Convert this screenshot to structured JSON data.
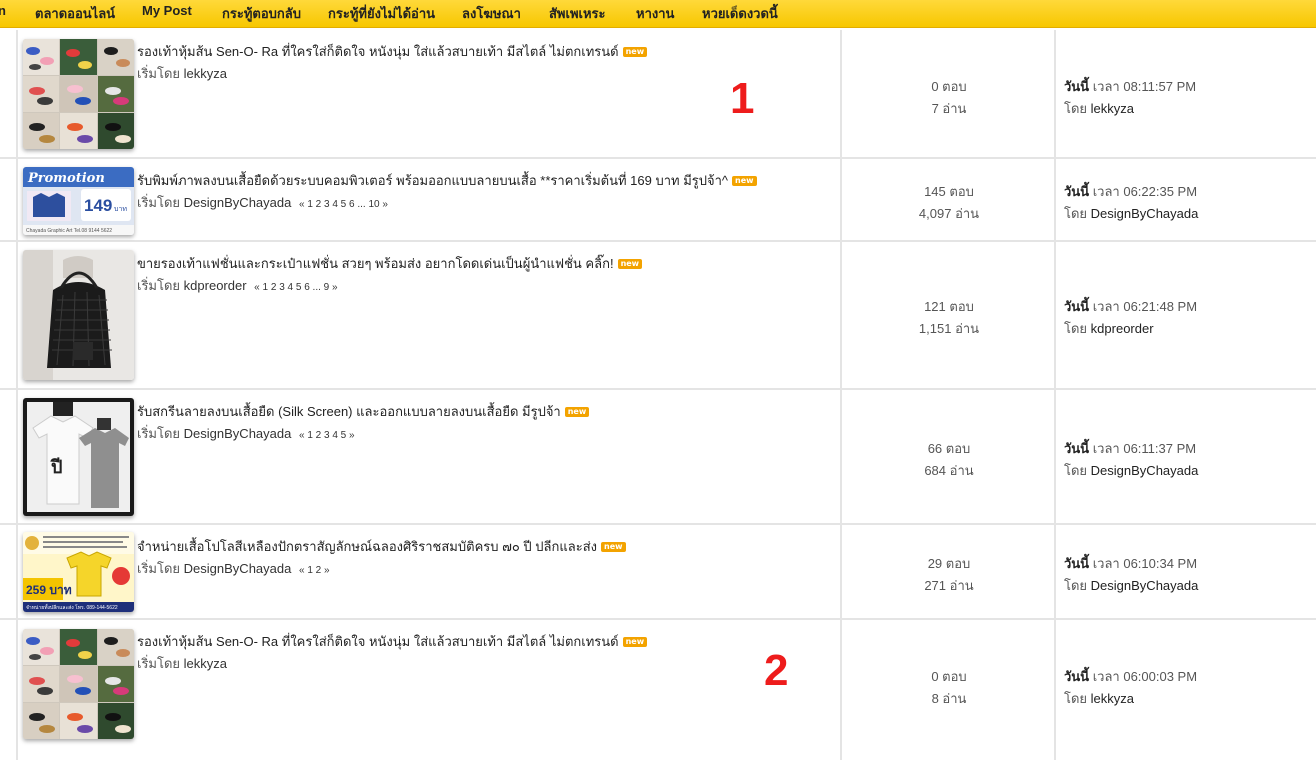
{
  "nav": {
    "items": [
      "n",
      "ตลาดออนไลน์",
      "My Post",
      "กระทู้ตอบกลับ",
      "กระทู้ที่ยังไม่ได้อ่าน",
      "ลงโฆษณา",
      "สัพเพเหระ",
      "หางาน",
      "หวยเด็ดงวดนี้"
    ]
  },
  "labels": {
    "started_by": "เริ่มโดย",
    "today": "วันนี้",
    "time_prefix": "เวลา",
    "by": "โดย",
    "replies_suffix": "ตอบ",
    "views_suffix": "อ่าน",
    "new_badge": "new"
  },
  "topics": [
    {
      "title": "รองเท้าหุ้มส้น Sen-O- Ra ที่ใครใส่ก็ติดใจ หนังนุ่ม ใส่แล้วสบายเท้า มีสไตล์ ไม่ตกเทรนด์",
      "starter": "lekkyza",
      "pages": "",
      "replies": "0",
      "views": "7",
      "last_time": "08:11:57 PM",
      "last_user": "lekkyza",
      "marker": "1"
    },
    {
      "title": "รับพิมพ์ภาพลงบนเสื้อยืดด้วยระบบคอมพิวเตอร์ พร้อมออกแบบลายบนเสื้อ **ราคาเริ่มต้นที่ 169 บาท มีรูปจ้า^",
      "starter": "DesignByChayada",
      "pages": "« 1 2 3 4 5 6 ... 10 »",
      "replies": "145",
      "views": "4,097",
      "last_time": "06:22:35 PM",
      "last_user": "DesignByChayada",
      "marker": ""
    },
    {
      "title": "ขายรองเท้าแฟชั่นและกระเป๋าแฟชั่น สวยๆ พร้อมส่ง อยากโดดเด่นเป็นผู้นำแฟชั่น คลิ๊ก!",
      "starter": "kdpreorder",
      "pages": "« 1 2 3 4 5 6 ... 9 »",
      "replies": "121",
      "views": "1,151",
      "last_time": "06:21:48 PM",
      "last_user": "kdpreorder",
      "marker": ""
    },
    {
      "title": "รับสกรีนลายลงบนเสื้อยืด (Silk Screen) และออกแบบลายลงบนเสื้อยืด มีรูปจ้า",
      "starter": "DesignByChayada",
      "pages": "« 1 2 3 4 5 »",
      "replies": "66",
      "views": "684",
      "last_time": "06:11:37 PM",
      "last_user": "DesignByChayada",
      "marker": ""
    },
    {
      "title": "จำหน่ายเสื้อโปโลสีเหลืองปักตราสัญลักษณ์ฉลองศิริราชสมบัติครบ ๗๐ ปี ปลีกและส่ง",
      "starter": "DesignByChayada",
      "pages": "« 1 2 »",
      "replies": "29",
      "views": "271",
      "last_time": "06:10:34 PM",
      "last_user": "DesignByChayada",
      "marker": ""
    },
    {
      "title": "รองเท้าหุ้มส้น Sen-O- Ra ที่ใครใส่ก็ติดใจ หนังนุ่ม ใส่แล้วสบายเท้า มีสไตล์ ไม่ตกเทรนด์",
      "starter": "lekkyza",
      "pages": "",
      "replies": "0",
      "views": "8",
      "last_time": "06:00:03 PM",
      "last_user": "lekkyza",
      "marker": "2"
    }
  ],
  "thumb_texts": {
    "promo_word": "Promotion",
    "promo_price": "149",
    "promo_unit": "บาท",
    "promo_shop": "Chayada Graphic Art Tel.08 9144 5622",
    "polo_price": "259 บาท",
    "polo_contact": "จำหน่ายทั้งปลีกและส่ง โทร. 089-144-5622"
  },
  "colors": {
    "nav_bg": "#f7c700",
    "new_badge": "#f3a300",
    "marker": "#ee1c1c",
    "border": "#e4e4e4"
  }
}
